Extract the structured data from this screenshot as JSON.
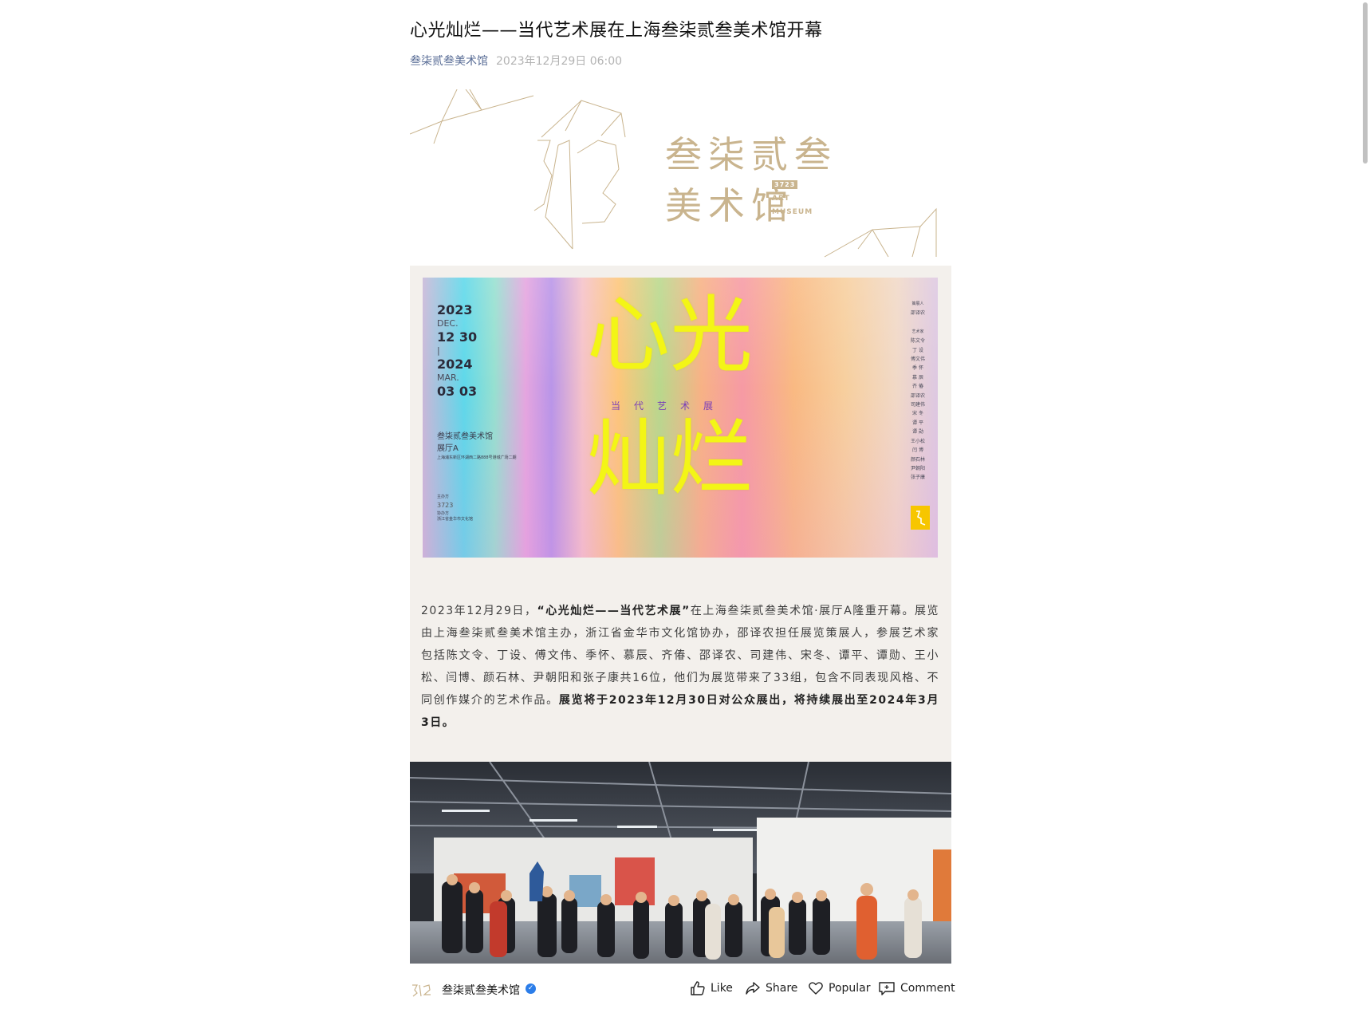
{
  "article": {
    "title": "心光灿烂——当代艺术展在上海叁柒贰叁美术馆开幕",
    "account": "叁柒贰叁美术馆",
    "date": "2023年12月29日 06:00"
  },
  "logo": {
    "cn_line1": "叁柒贰叁",
    "cn_line2": "美术馆",
    "badge": "3723",
    "en_line1": "ART",
    "en_line2": "MUSEUM"
  },
  "poster": {
    "year_start": "2023",
    "month_start": "DEC.",
    "day_start": "12 30",
    "separator": "|",
    "year_end": "2024",
    "month_end": "MAR.",
    "day_end": "03 03",
    "title_line1": "心光",
    "title_line2": "灿烂",
    "subtitle": "当代艺术展",
    "venue": "叁柒贰叁美术馆",
    "hall": "展厅A",
    "address": "上海浦东新区环湖西二路888号港城广场二期",
    "organizer_label": "主办方",
    "co_organizer_label": "协办方",
    "co_organizer": "浙江省金华市文化馆",
    "curator_label": "策展人",
    "curator": "邵译农",
    "artists_label": "艺术家",
    "artists": [
      "陈文令",
      "丁 设",
      "傅文伟",
      "季 怀",
      "慕 辰",
      "齐 偆",
      "邵译农",
      "司建伟",
      "宋 冬",
      "谭 平",
      "谭 勋",
      "王小松",
      "闫 博",
      "颜石林",
      "尹朝阳",
      "张子康"
    ]
  },
  "paragraph": {
    "part1": "2023年12月29日，",
    "part2_bold": "“心光灿烂——当代艺术展”",
    "part3": "在上海叁柒贰叁美术馆·展厅A隆重开幕。展览由上海叁柒贰叁美术馆主办，浙江省金华市文化馆协办，邵译农担任展览策展人，参展艺术家包括陈文令、丁设、傅文伟、季怀、慕辰、齐偆、邵译农、司建伟、宋冬、谭平、谭勋、王小松、闫博、颜石林、尹朝阳和张子康共16位，他们为展览带来了33组，包含不同表现风格、不同创作媒介的艺术作品。",
    "part4_bold": "展览将于2023年12月30日对公众展出，将持续展出至2024年3月3日。"
  },
  "footer": {
    "account": "叁柒贰叁美术馆",
    "avatar_text": "3723",
    "like_label": "Like",
    "share_label": "Share",
    "popular_label": "Popular",
    "comment_label": "Comment"
  },
  "icons": {
    "verified": "verified-badge-icon",
    "like": "thumbs-up-icon",
    "share": "share-arrow-icon",
    "popular": "heart-icon",
    "comment": "comment-bubble-icon"
  },
  "colors": {
    "account_link": "#576b95",
    "date_gray": "#b3b3b3",
    "content_bg": "#f3f0ec",
    "logo_gold": "#c9b48e",
    "poster_title": "#f3f516",
    "verify_blue": "#2b7de9"
  }
}
